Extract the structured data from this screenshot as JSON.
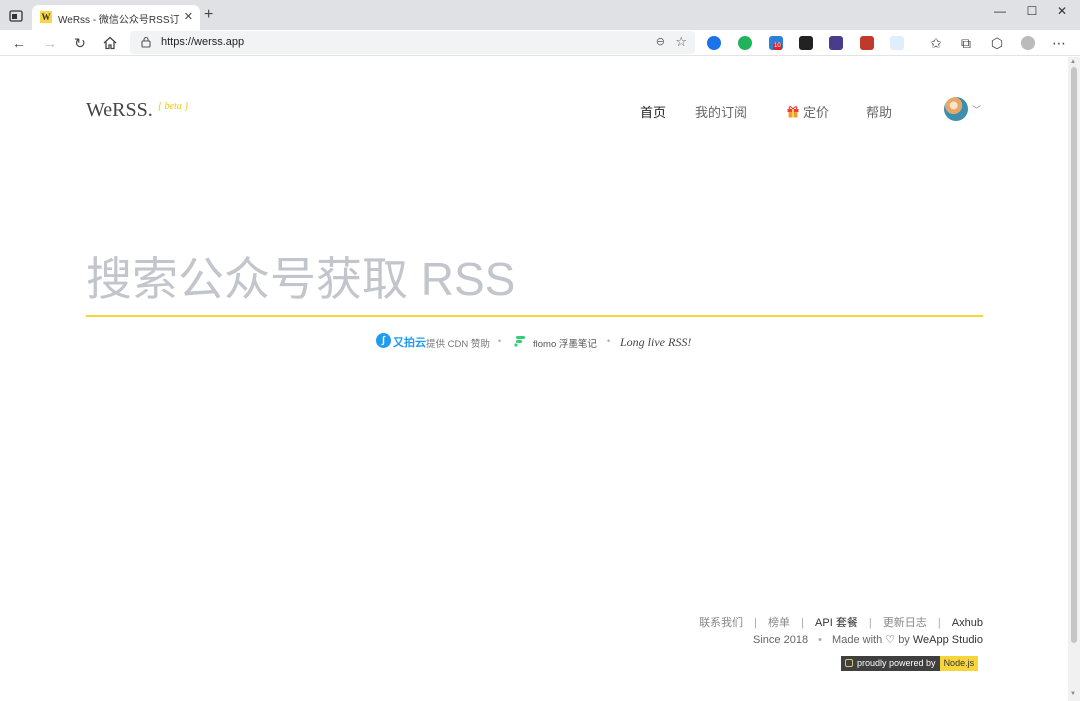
{
  "browser": {
    "tab_title": "WeRss - 微信公众号RSS订阅",
    "tab_favicon_letter": "W",
    "url": "https://werss.app",
    "ext_badge_count": "10",
    "window_controls": {
      "minimize": "—",
      "maximize": "☐",
      "close": "✕"
    }
  },
  "site": {
    "logo": "WeRSS.",
    "beta": "{ beta }"
  },
  "nav": {
    "home": "首页",
    "subscriptions": "我的订阅",
    "pricing": "定价",
    "help": "帮助"
  },
  "search": {
    "placeholder": "搜索公众号获取 RSS"
  },
  "sponsors": {
    "upyun_name": "又拍云",
    "upyun_text": "提供 CDN 赞助",
    "flomo_text": "flomo 浮墨笔记",
    "tagline": "Long live RSS!"
  },
  "footer": {
    "contact": "联系我们",
    "ranking": "榜单",
    "api": "API 套餐",
    "changelog": "更新日志",
    "axhub": "Axhub",
    "separator": "|",
    "since": "Since 2018",
    "made_with": "Made with",
    "heart": "♡",
    "by": "by",
    "studio": "WeApp Studio",
    "powered": "proudly powered by",
    "node": "Node.js"
  },
  "colors": {
    "accent": "#f6d53b",
    "upyun": "#1f9bf0",
    "flomo": "#30cf79"
  }
}
